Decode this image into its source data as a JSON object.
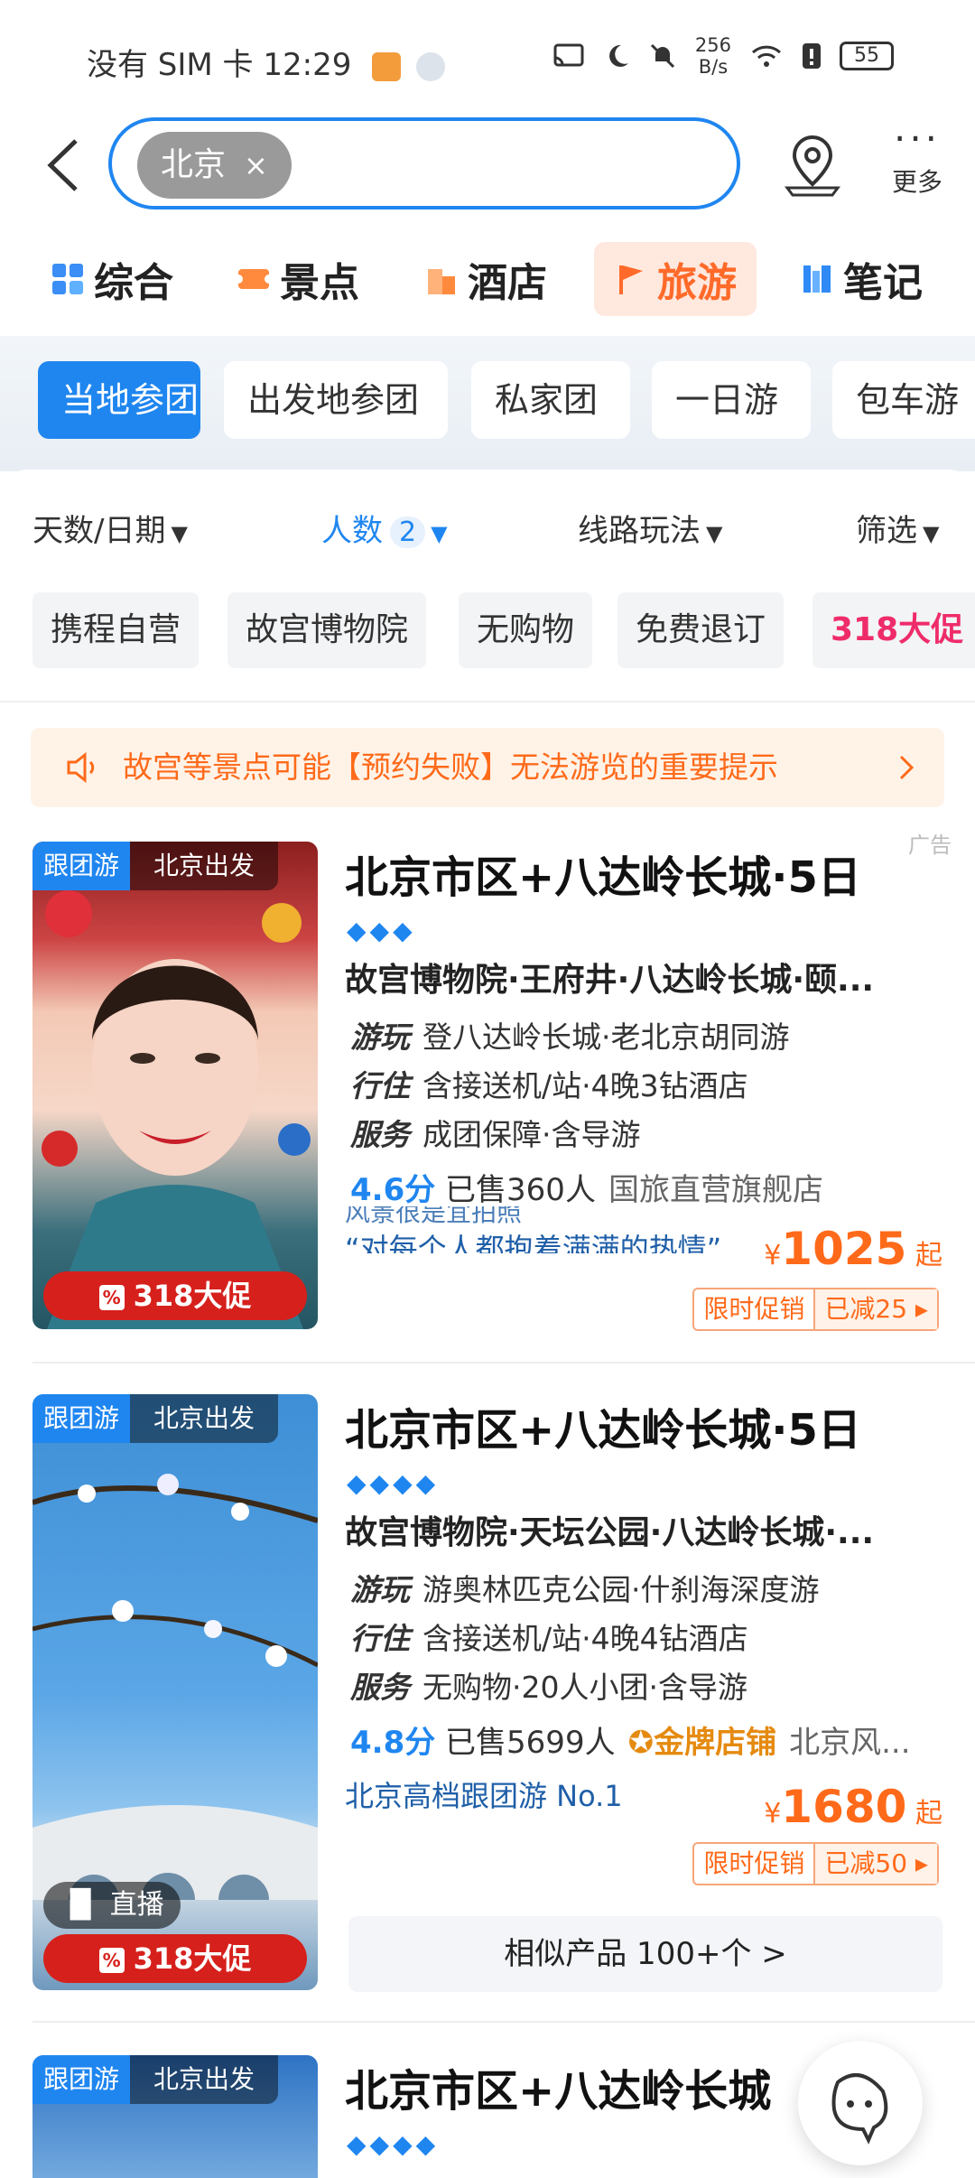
{
  "status": {
    "left": "没有 SIM 卡 12:29",
    "speed_top": "256",
    "speed_bottom": "B/s",
    "battery": "55"
  },
  "header": {
    "search_chip": "北京",
    "chip_close": "×",
    "more_label": "更多"
  },
  "tabs": [
    {
      "label": "综合",
      "icon_color": "#3a8ef6"
    },
    {
      "label": "景点",
      "icon_color": "#ff8a3d"
    },
    {
      "label": "酒店",
      "icon_color": "#ff9a4a"
    },
    {
      "label": "旅游",
      "icon_color": "#ff6a2a"
    },
    {
      "label": "笔记",
      "icon_color": "#2f8af5"
    }
  ],
  "subcats": [
    "当地参团",
    "出发地参团",
    "私家团",
    "一日游",
    "包车游"
  ],
  "filters": {
    "days": "天数/日期",
    "people": "人数",
    "people_count": "2",
    "route": "线路玩法",
    "filter": "筛选"
  },
  "tags": [
    "携程自营",
    "故宫博物院",
    "无购物",
    "免费退订",
    "318大促"
  ],
  "notice": {
    "text": "故宫等景点可能【预约失败】无法游览的重要提示",
    "ad": "广告"
  },
  "products": [
    {
      "tag_type": "跟团游",
      "tag_from": "北京出发",
      "title": "北京市区+八达岭长城·5日",
      "diamonds": "◆◆◆",
      "route": "故宫博物院·王府井·八达岭长城·颐...",
      "play_label": "游玩",
      "play": "登八达岭长城·老北京胡同游",
      "stay_label": "行住",
      "stay": "含接送机/站·4晚3钻酒店",
      "svc_label": "服务",
      "svc": "成团保障·含导游",
      "score": "4.6分",
      "sold": "已售360人",
      "shop": "国旅直营旗舰店",
      "quote_top": "风景很是宜拍照",
      "quote": "“对每个人都抱着满满的热情”",
      "currency": "¥",
      "price": "1025",
      "price_suffix": "起",
      "deal_a": "限时促销",
      "deal_b": "已减25",
      "promo": "318大促"
    },
    {
      "tag_type": "跟团游",
      "tag_from": "北京出发",
      "title": "北京市区+八达岭长城·5日",
      "diamonds": "◆◆◆◆",
      "route": "故宫博物院·天坛公园·八达岭长城·...",
      "play_label": "游玩",
      "play": "游奥林匹克公园·什刹海深度游",
      "stay_label": "行住",
      "stay": "含接送机/站·4晚4钻酒店",
      "svc_label": "服务",
      "svc": "无购物·20人小团·含导游",
      "score": "4.8分",
      "sold": "已售5699人",
      "gold": "金牌店铺",
      "shop": "北京风...",
      "quote": "北京高档跟团游 No.1",
      "currency": "¥",
      "price": "1680",
      "price_suffix": "起",
      "deal_a": "限时促销",
      "deal_b": "已减50",
      "live": "直播",
      "promo": "318大促",
      "similar": "相似产品 100+个 >"
    },
    {
      "tag_type": "跟团游",
      "tag_from": "北京出发",
      "title": "北京市区+八达岭长城",
      "diamonds": "◆◆◆◆"
    }
  ]
}
